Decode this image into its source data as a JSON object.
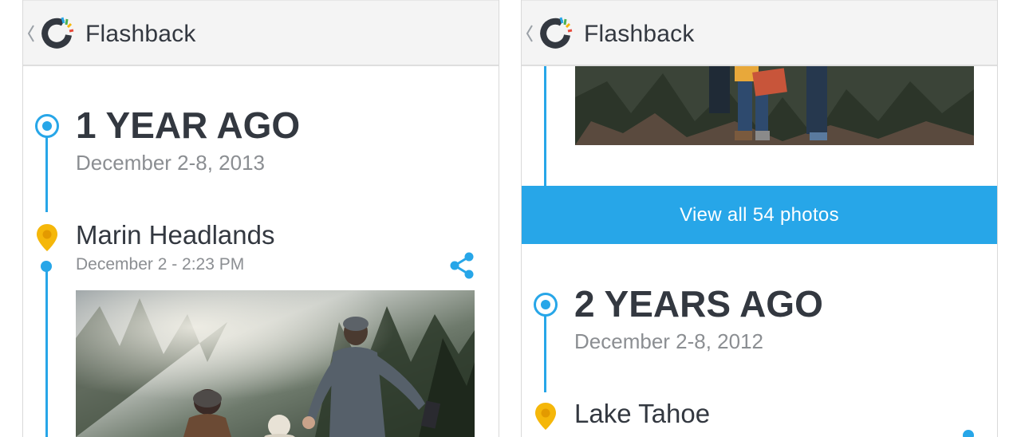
{
  "left_screen": {
    "app_bar": {
      "title": "Flashback",
      "back_icon": "chevron-left-icon",
      "logo_icon": "flashback-logo-icon"
    },
    "section": {
      "heading": "1 YEAR AGO",
      "date_range": "December 2-8, 2013"
    },
    "place": {
      "name": "Marin Headlands",
      "time": "December 2 - 2:23 PM",
      "share_icon": "share-icon",
      "pin_icon": "location-pin-icon"
    }
  },
  "right_screen": {
    "app_bar": {
      "title": "Flashback",
      "back_icon": "chevron-left-icon",
      "logo_icon": "flashback-logo-icon"
    },
    "view_all_button": "View all 54 photos",
    "section": {
      "heading": "2 YEARS AGO",
      "date_range": "December 2-8, 2012"
    },
    "place": {
      "name": "Lake Tahoe",
      "pin_icon": "location-pin-icon"
    }
  },
  "colors": {
    "accent_blue": "#27a6e8",
    "pin_yellow": "#f5b70a",
    "text_dark": "#333840",
    "text_gray": "#8b8e92",
    "app_bar_bg": "#f4f4f4"
  }
}
